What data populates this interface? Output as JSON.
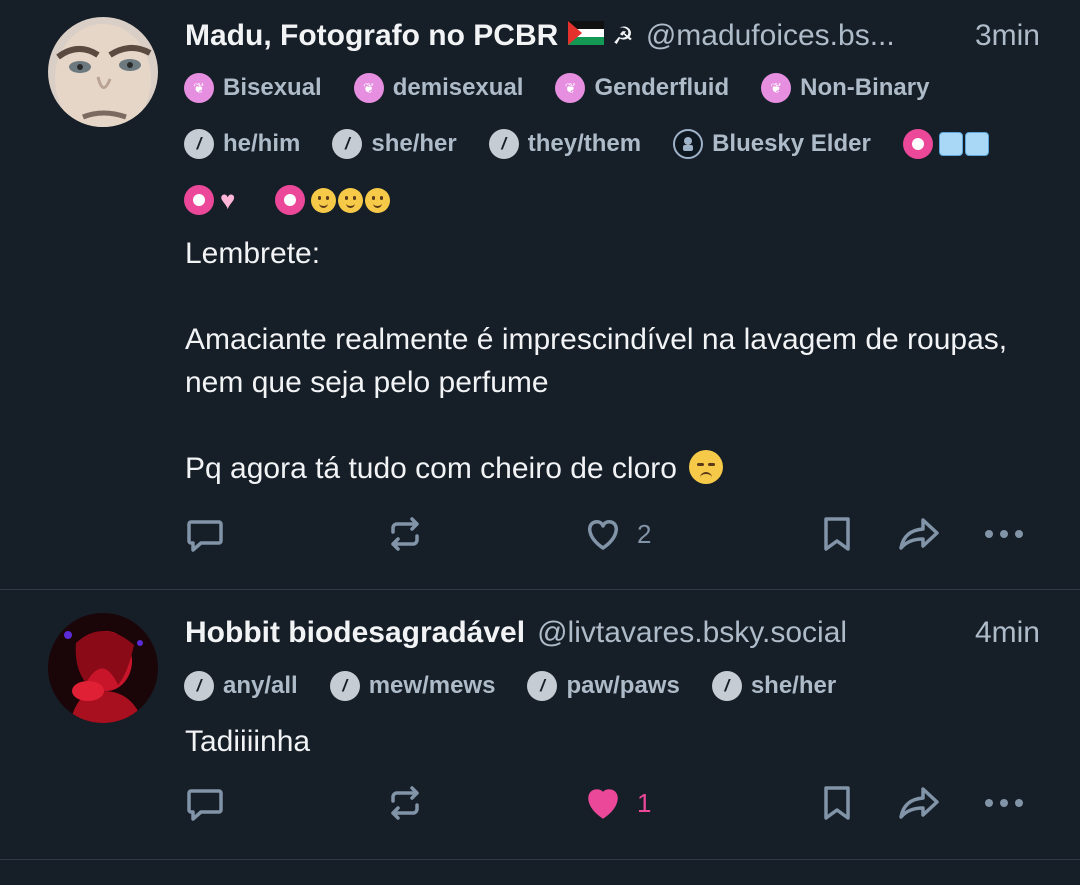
{
  "posts": [
    {
      "author_name": "Madu, Fotografo no PCBR",
      "hammer_glyph": "☭",
      "handle": "@madufoices.bs...",
      "time": "3min",
      "labels_row1": [
        "Bisexual",
        "demisexual",
        "Genderfluid",
        "Non-Binary"
      ],
      "labels_row2": [
        "he/him",
        "she/her",
        "they/them",
        "Bluesky Elder"
      ],
      "text_line1": "Lembrete:",
      "text_line2": "Amaciante realmente é imprescindível na lavagem de roupas, nem que seja pelo perfume",
      "text_line3": "Pq agora tá tudo com cheiro de cloro",
      "like_count": "2",
      "liked": false
    },
    {
      "author_name": "Hobbit biodesagradável",
      "handle": "@livtavares.bsky.social",
      "time": "4min",
      "labels_row1": [
        "any/all",
        "mew/mews",
        "paw/paws",
        "she/her"
      ],
      "text_line1": "Tadiiiinha",
      "like_count": "1",
      "liked": true
    }
  ],
  "icons": {
    "reply": "reply-icon",
    "repost": "repost-icon",
    "like": "heart-icon",
    "bookmark": "bookmark-icon",
    "share": "share-icon",
    "more": "more-icon"
  },
  "colors": {
    "background": "#161e27",
    "text": "#f1f3f5",
    "muted": "#aebbc9",
    "action": "#8194a8",
    "like_active": "#ec4899",
    "label_pink": "#e68fe0"
  }
}
